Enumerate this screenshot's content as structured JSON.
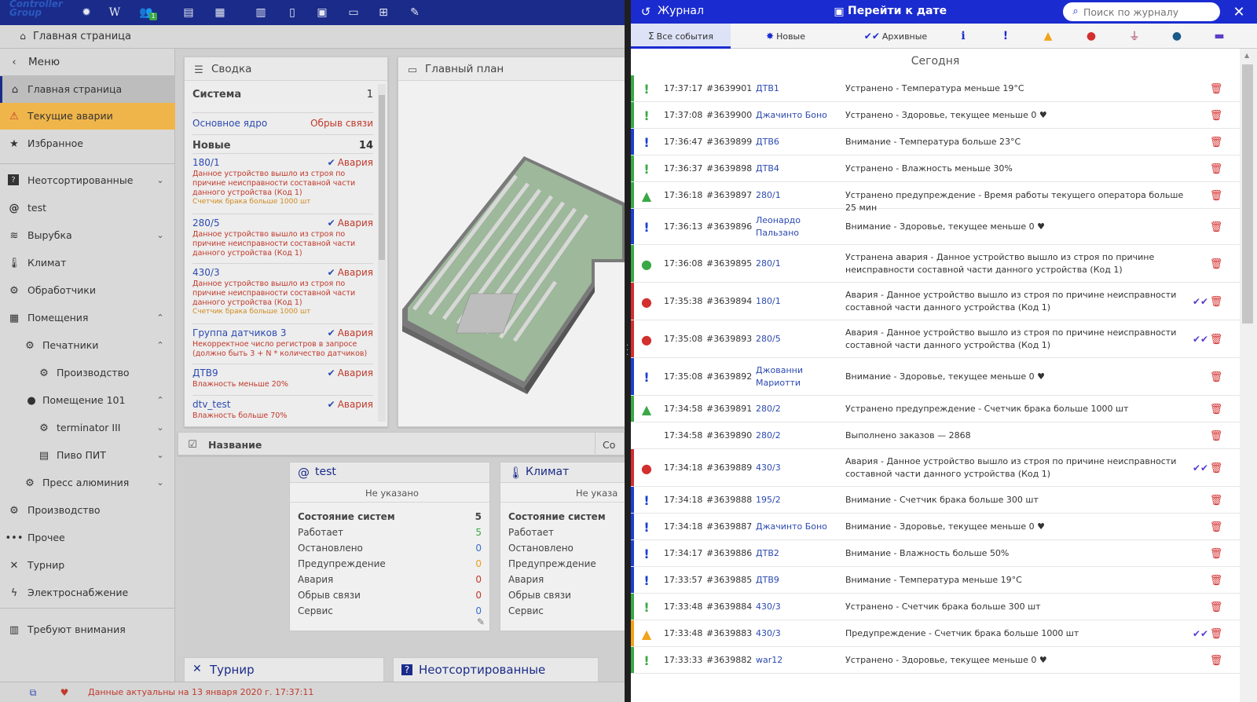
{
  "app": {
    "logo_text": "Controller Group",
    "breadcrumb": "Главная страница",
    "toolbar_icons": [
      "bug-icon",
      "wiki-icon",
      "users-icon",
      "layers-icon",
      "server-settings-icon",
      "bar-chart-icon",
      "document-icon",
      "calendar-icon",
      "folder-icon",
      "folder-plus-icon",
      "folder-edit-icon"
    ],
    "users_badge": "1"
  },
  "sidebar": {
    "menu_label": "Меню",
    "items": [
      {
        "label": "Главная страница",
        "icon": "home-icon",
        "active": true
      },
      {
        "label": "Текущие аварии",
        "icon": "warning-icon",
        "alarm": true
      },
      {
        "label": "Избранное",
        "icon": "star-icon"
      },
      {
        "label": "Неотсортированные",
        "icon": "question-icon",
        "chevron": "down"
      },
      {
        "label": "test",
        "icon": "at-icon"
      },
      {
        "label": "Вырубка",
        "icon": "layers-icon",
        "chevron": "down"
      },
      {
        "label": "Климат",
        "icon": "thermometer-icon"
      },
      {
        "label": "Обработчики",
        "icon": "handlers-icon"
      },
      {
        "label": "Помещения",
        "icon": "rooms-icon",
        "chevron": "up"
      },
      {
        "label": "Печатники",
        "icon": "printers-icon",
        "chevron": "up",
        "indent": 1
      },
      {
        "label": "Производство",
        "icon": "production-icon",
        "indent": 2
      },
      {
        "label": "Помещение 101",
        "icon": "room-icon",
        "chevron": "up",
        "indent": 1
      },
      {
        "label": "terminator III",
        "icon": "terminator-icon",
        "chevron": "down",
        "indent": 2
      },
      {
        "label": "Пиво ПИТ",
        "icon": "grid-icon",
        "chevron": "down",
        "indent": 2
      },
      {
        "label": "Пресс алюминия",
        "icon": "press-icon",
        "chevron": "down",
        "indent": 1
      },
      {
        "label": "Производство",
        "icon": "production-icon"
      },
      {
        "label": "Прочее",
        "icon": "more-icon"
      },
      {
        "label": "Турнир",
        "icon": "tournament-icon"
      },
      {
        "label": "Электроснабжение",
        "icon": "power-icon"
      },
      {
        "label": "Требуют внимания",
        "icon": "attention-icon"
      }
    ]
  },
  "summary": {
    "title": "Сводка",
    "system_label": "Система",
    "system_count": "1",
    "core_label": "Основное ядро",
    "core_status": "Обрыв связи",
    "new_label": "Новые",
    "new_count": "14",
    "alarms": [
      {
        "name": "180/1",
        "status": "Авария",
        "desc": "Данное устройство вышло из строя по причине неисправности составной части данного устройства (Код 1)",
        "extra": "Счетчик брака больше 1000 шт"
      },
      {
        "name": "280/5",
        "status": "Авария",
        "desc": "Данное устройство вышло из строя по причине неисправности составной части данного устройства (Код 1)",
        "extra": ""
      },
      {
        "name": "430/3",
        "status": "Авария",
        "desc": "Данное устройство вышло из строя по причине неисправности составной части данного устройства (Код 1)",
        "extra": "Счетчик брака больше 1000 шт"
      },
      {
        "name": "Группа датчиков 3",
        "status": "Авария",
        "desc": "Некорректное число регистров в запросе (должно быть 3 + N * количество датчиков)",
        "extra": ""
      },
      {
        "name": "ДТВ9",
        "status": "Авария",
        "desc": "Влажность меньше 20%",
        "extra": ""
      },
      {
        "name": "dtv_test",
        "status": "Авария",
        "desc": "Влажность больше 70%",
        "extra": ""
      }
    ]
  },
  "plan": {
    "title": "Главный план"
  },
  "name_bar": {
    "label": "Название",
    "right_label": "Со"
  },
  "tiles": [
    {
      "title": "test",
      "icon": "at-icon",
      "not_set": "Не указано",
      "rows": [
        {
          "label": "Состояние систем",
          "value": "5",
          "bold": true,
          "color": "#333"
        },
        {
          "label": "Работает",
          "value": "5",
          "color": "#3aa845"
        },
        {
          "label": "Остановлено",
          "value": "0",
          "color": "#3a6fd0"
        },
        {
          "label": "Предупреждение",
          "value": "0",
          "color": "#e6a020"
        },
        {
          "label": "Авария",
          "value": "0",
          "color": "#c0392b"
        },
        {
          "label": "Обрыв связи",
          "value": "0",
          "color": "#c0392b"
        },
        {
          "label": "Сервис",
          "value": "0",
          "color": "#3a6fd0"
        }
      ]
    },
    {
      "title": "Климат",
      "icon": "thermometer-icon",
      "not_set": "Не указа",
      "rows": [
        {
          "label": "Состояние систем",
          "value": "",
          "bold": true
        },
        {
          "label": "Работает",
          "value": ""
        },
        {
          "label": "Остановлено",
          "value": ""
        },
        {
          "label": "Предупреждение",
          "value": ""
        },
        {
          "label": "Авария",
          "value": ""
        },
        {
          "label": "Обрыв связи",
          "value": ""
        },
        {
          "label": "Сервис",
          "value": ""
        }
      ]
    }
  ],
  "bottom_tiles": [
    {
      "title": "Турнир",
      "icon": "tournament-icon"
    },
    {
      "title": "Неотсортированные",
      "icon": "question-icon"
    }
  ],
  "status_bar": {
    "text": "Данные актуальны на 13 января 2020 г. 17:37:11"
  },
  "journal": {
    "title": "Журнал",
    "goto_date": "Перейти к дате",
    "search_placeholder": "Поиск по журналу",
    "tabs": [
      {
        "label": "Все события",
        "icon": "sigma-icon"
      },
      {
        "label": "Новые",
        "icon": "new-badge-icon"
      },
      {
        "label": "Архивные",
        "icon": "double-check-icon"
      }
    ],
    "filters": [
      "info-filter-icon",
      "exclamation-filter-icon",
      "warning-filter-icon",
      "alarm-filter-icon",
      "plug-filter-icon",
      "user-filter-icon",
      "chat-filter-icon"
    ],
    "section": "Сегодня",
    "entries": [
      {
        "time": "17:37:17",
        "id": "#3639901",
        "device": "ДТВ1",
        "message": "Устранено - Температура меньше 19°C",
        "kind": "resolved"
      },
      {
        "time": "17:37:08",
        "id": "#3639900",
        "device": "Джачинто Боно",
        "message": "Устранено - Здоровье, текущее меньше 0 ♥",
        "kind": "resolved"
      },
      {
        "time": "17:36:47",
        "id": "#3639899",
        "device": "ДТВ6",
        "message": "Внимание - Температура больше 23°C",
        "kind": "attention"
      },
      {
        "time": "17:36:37",
        "id": "#3639898",
        "device": "ДТВ4",
        "message": "Устранено - Влажность меньше 30%",
        "kind": "resolved"
      },
      {
        "time": "17:36:18",
        "id": "#3639897",
        "device": "280/1",
        "message": "Устранено предупреждение - Время работы текущего оператора больше 25 мин",
        "kind": "resolved-warning"
      },
      {
        "time": "17:36:13",
        "id": "#3639896",
        "device": "Леонардо Пальзано",
        "message": "Внимание - Здоровье, текущее меньше 0 ♥",
        "kind": "attention"
      },
      {
        "time": "17:36:08",
        "id": "#3639895",
        "device": "280/1",
        "message": "Устранена авария - Данное устройство вышло из строя по причине неисправности составной части данного устройства (Код 1)",
        "kind": "resolved-alarm"
      },
      {
        "time": "17:35:38",
        "id": "#3639894",
        "device": "180/1",
        "message": "Авария - Данное устройство вышло из строя по причине неисправности составной части данного устройства (Код 1)",
        "kind": "alarm",
        "ack": true
      },
      {
        "time": "17:35:08",
        "id": "#3639893",
        "device": "280/5",
        "message": "Авария - Данное устройство вышло из строя по причине неисправности составной части данного устройства (Код 1)",
        "kind": "alarm",
        "ack": true
      },
      {
        "time": "17:35:08",
        "id": "#3639892",
        "device": "Джованни Мариотти",
        "message": "Внимание - Здоровье, текущее меньше 0 ♥",
        "kind": "attention"
      },
      {
        "time": "17:34:58",
        "id": "#3639891",
        "device": "280/2",
        "message": "Устранено предупреждение - Счетчик брака больше 1000 шт",
        "kind": "resolved-warning"
      },
      {
        "time": "17:34:58",
        "id": "#3639890",
        "device": "280/2",
        "message": "Выполнено заказов — 2868",
        "kind": "info"
      },
      {
        "time": "17:34:18",
        "id": "#3639889",
        "device": "430/3",
        "message": "Авария - Данное устройство вышло из строя по причине неисправности составной части данного устройства (Код 1)",
        "kind": "alarm",
        "ack": true
      },
      {
        "time": "17:34:18",
        "id": "#3639888",
        "device": "195/2",
        "message": "Внимание - Счетчик брака больше 300 шт",
        "kind": "attention"
      },
      {
        "time": "17:34:18",
        "id": "#3639887",
        "device": "Джачинто Боно",
        "message": "Внимание - Здоровье, текущее меньше 0 ♥",
        "kind": "attention"
      },
      {
        "time": "17:34:17",
        "id": "#3639886",
        "device": "ДТВ2",
        "message": "Внимание - Влажность больше 50%",
        "kind": "attention"
      },
      {
        "time": "17:33:57",
        "id": "#3639885",
        "device": "ДТВ9",
        "message": "Внимание - Температура меньше 19°C",
        "kind": "attention"
      },
      {
        "time": "17:33:48",
        "id": "#3639884",
        "device": "430/3",
        "message": "Устранено - Счетчик брака больше 300 шт",
        "kind": "resolved"
      },
      {
        "time": "17:33:48",
        "id": "#3639883",
        "device": "430/3",
        "message": "Предупреждение - Счетчик брака больше 1000 шт",
        "kind": "warning",
        "ack": true
      },
      {
        "time": "17:33:33",
        "id": "#3639882",
        "device": "war12",
        "message": "Устранено - Здоровье, текущее меньше 0 ♥",
        "kind": "resolved"
      }
    ]
  },
  "colors": {
    "brand": "#1a2bd0",
    "resolved": "#3aa845",
    "attention": "#1a3fd0",
    "alarm": "#d32f2f",
    "warning": "#f2a31b"
  }
}
